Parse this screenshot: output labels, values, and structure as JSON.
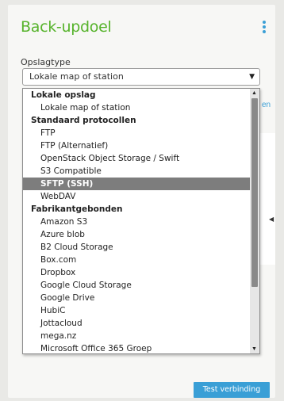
{
  "header": {
    "title": "Back-updoel",
    "menu_icon": "more-vertical-icon"
  },
  "form": {
    "storage_type_label": "Opslagtype",
    "storage_type_value": "Lokale map of station"
  },
  "background": {
    "partial_link": "en"
  },
  "dropdown": {
    "options": [
      {
        "label": "Lokale opslag",
        "type": "group"
      },
      {
        "label": "Lokale map of station",
        "type": "item"
      },
      {
        "label": "Standaard protocollen",
        "type": "group"
      },
      {
        "label": "FTP",
        "type": "item"
      },
      {
        "label": "FTP (Alternatief)",
        "type": "item"
      },
      {
        "label": "OpenStack Object Storage / Swift",
        "type": "item"
      },
      {
        "label": "S3 Compatible",
        "type": "item"
      },
      {
        "label": "SFTP (SSH)",
        "type": "item",
        "selected": true
      },
      {
        "label": "WebDAV",
        "type": "item"
      },
      {
        "label": "Fabrikantgebonden",
        "type": "group"
      },
      {
        "label": "Amazon S3",
        "type": "item"
      },
      {
        "label": "Azure blob",
        "type": "item"
      },
      {
        "label": "B2 Cloud Storage",
        "type": "item"
      },
      {
        "label": "Box.com",
        "type": "item"
      },
      {
        "label": "Dropbox",
        "type": "item"
      },
      {
        "label": "Google Cloud Storage",
        "type": "item"
      },
      {
        "label": "Google Drive",
        "type": "item"
      },
      {
        "label": "HubiC",
        "type": "item"
      },
      {
        "label": "Jottacloud",
        "type": "item"
      },
      {
        "label": "mega.nz",
        "type": "item"
      },
      {
        "label": "Microsoft Office 365 Groep",
        "type": "item"
      }
    ]
  },
  "footer": {
    "test_button": "Test verbinding"
  },
  "colors": {
    "accent_green": "#56b32b",
    "accent_blue": "#3a9fd6",
    "selected_bg": "#7d7d7d"
  }
}
